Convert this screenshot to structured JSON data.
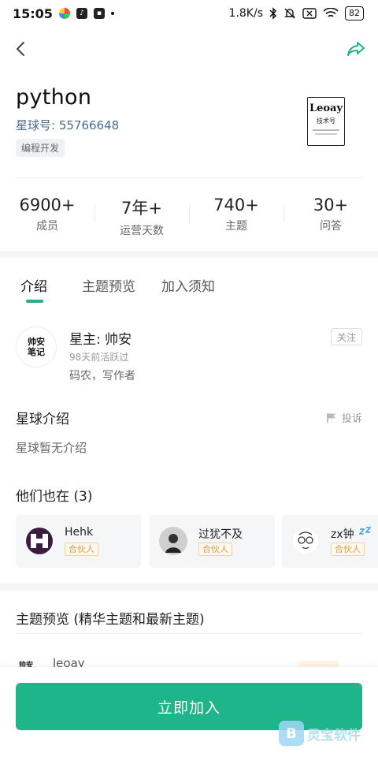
{
  "status_bar": {
    "time": "15:05",
    "net_speed": "1.8K/s",
    "battery": "82"
  },
  "header": {
    "title": "python",
    "planet_no": "星球号: 55766648",
    "tag": "编程开发",
    "logo_text": "Leoay",
    "logo_sub": "技术号"
  },
  "stats": [
    {
      "value": "6900+",
      "label": "成员"
    },
    {
      "value": "7年+",
      "label": "运营天数"
    },
    {
      "value": "740+",
      "label": "主题"
    },
    {
      "value": "30+",
      "label": "问答"
    }
  ],
  "tabs": [
    {
      "label": "介绍"
    },
    {
      "label": "主题预览"
    },
    {
      "label": "加入须知"
    }
  ],
  "owner": {
    "avatar_text": "帅安笔记",
    "name": "星主: 帅安",
    "active": "98天前活跃过",
    "desc": "码农，写作者",
    "follow_label": "关注"
  },
  "intro": {
    "title": "星球介绍",
    "report_label": "投诉",
    "text": "星球暂无介绍"
  },
  "also": {
    "title": "他们也在 (3)",
    "members": [
      {
        "name": "Hehk",
        "badge": "合伙人"
      },
      {
        "name": "过犹不及",
        "badge": "合伙人"
      },
      {
        "name": "zx钟",
        "badge": "合伙人"
      }
    ]
  },
  "topics": {
    "title": "主题预览 (精华主题和最新主题)",
    "peek_name": "leoay",
    "peek_avatar": "帅安"
  },
  "join_button": "立即加入",
  "watermark": "灵宝软件",
  "colors": {
    "accent": "#1fb58a",
    "link_blue": "#4a6a89",
    "badge_gold": "#d19b4b"
  }
}
